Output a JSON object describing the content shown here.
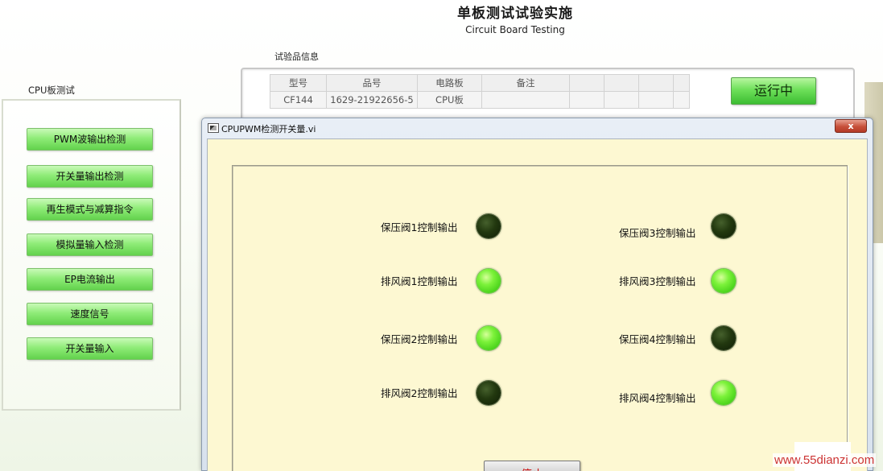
{
  "header": {
    "title": "单板测试试验实施",
    "subtitle": "Circuit Board Testing"
  },
  "sample_info": {
    "label": "试验品信息",
    "columns": [
      "型号",
      "品号",
      "电路板",
      "备注",
      "",
      "",
      "",
      ""
    ],
    "rows": [
      [
        "CF144",
        "1629-21922656-5",
        "CPU板",
        "",
        "",
        "",
        "",
        ""
      ]
    ],
    "run_button": "运行中"
  },
  "left_panel": {
    "label": "CPU板测试",
    "buttons": [
      "PWM波输出检测",
      "开关量输出检测",
      "再生模式与减算指令",
      "模拟量输入检测",
      "EP电流输出",
      "速度信号",
      "开关量输入"
    ]
  },
  "dialog": {
    "title": "CPUPWM检测开关量.vi",
    "close_glyph": "x",
    "indicators": [
      {
        "label": "保压阀1控制输出",
        "state": "off"
      },
      {
        "label": "排风阀1控制输出",
        "state": "on"
      },
      {
        "label": "保压阀2控制输出",
        "state": "on"
      },
      {
        "label": "排风阀2控制输出",
        "state": "off"
      },
      {
        "label": "保压阀3控制输出",
        "state": "off"
      },
      {
        "label": "排风阀3控制输出",
        "state": "on"
      },
      {
        "label": "保压阀4控制输出",
        "state": "off"
      },
      {
        "label": "排风阀4控制输出",
        "state": "on"
      }
    ],
    "stop_button": "停止"
  },
  "watermark": "www.55dianzi.com",
  "colors": {
    "accent_green": "#6ee05a",
    "led_on": "#7cf23a",
    "led_off": "#22380f",
    "dialog_bg": "#fdf8d2",
    "stop_text": "#cc1111"
  }
}
